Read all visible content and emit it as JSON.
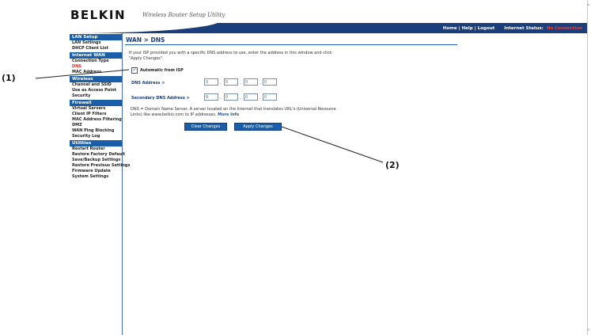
{
  "brand": {
    "logo": "BELKIN",
    "tagline": "Wireless Router Setup Utility"
  },
  "top_links": {
    "home": "Home",
    "help": "Help",
    "logout": "Logout",
    "internet_status_label": "Internet Status:",
    "internet_status_value": "No Connection"
  },
  "sidebar": {
    "sections": [
      {
        "header": "LAN Setup",
        "items": [
          "LAN Settings",
          "DHCP Client List"
        ]
      },
      {
        "header": "Internet WAN",
        "items": [
          "Connection Type",
          "DNS",
          "MAC Address"
        ]
      },
      {
        "header": "Wireless",
        "items": [
          "Channel and SSID",
          "Use as Access Point",
          "Security"
        ]
      },
      {
        "header": "Firewall",
        "items": [
          "Virtual Servers",
          "Client IP Filters",
          "MAC Address Filtering",
          "DMZ",
          "WAN Ping Blocking",
          "Security Log"
        ]
      },
      {
        "header": "Utilities",
        "items": [
          "Restart Router",
          "Restore Factory Default",
          "Save/Backup Settings",
          "Restore Previous Settings",
          "Firmware Update",
          "System Settings"
        ]
      }
    ]
  },
  "main": {
    "title": "WAN > DNS",
    "intro": "If your ISP provided you with a specific DNS address to use, enter the address in this window and click \"Apply Changes\".",
    "auto_checkbox_label": "Automatic from ISP",
    "auto_checked": true,
    "dns_label": "DNS Address >",
    "secondary_dns_label": "Secondary DNS Address >",
    "dns_fields": [
      "0",
      "0",
      "0",
      "0"
    ],
    "secondary_dns_fields": [
      "0",
      "0",
      "0",
      "0"
    ],
    "footnote": "DNS = Domain Name Server. A server located on the Internet that translates URL's (Universal Resource Links) like www.belkin.com to IP addresses.",
    "more_info": "More Info",
    "clear_button": "Clear Changes",
    "apply_button": "Apply Changes"
  },
  "callouts": {
    "one": "(1)",
    "two": "(2)"
  },
  "colors": {
    "header_blue": "#1a3d7c",
    "menu_blue": "#1a5ea8",
    "status_red": "#e0443a"
  }
}
